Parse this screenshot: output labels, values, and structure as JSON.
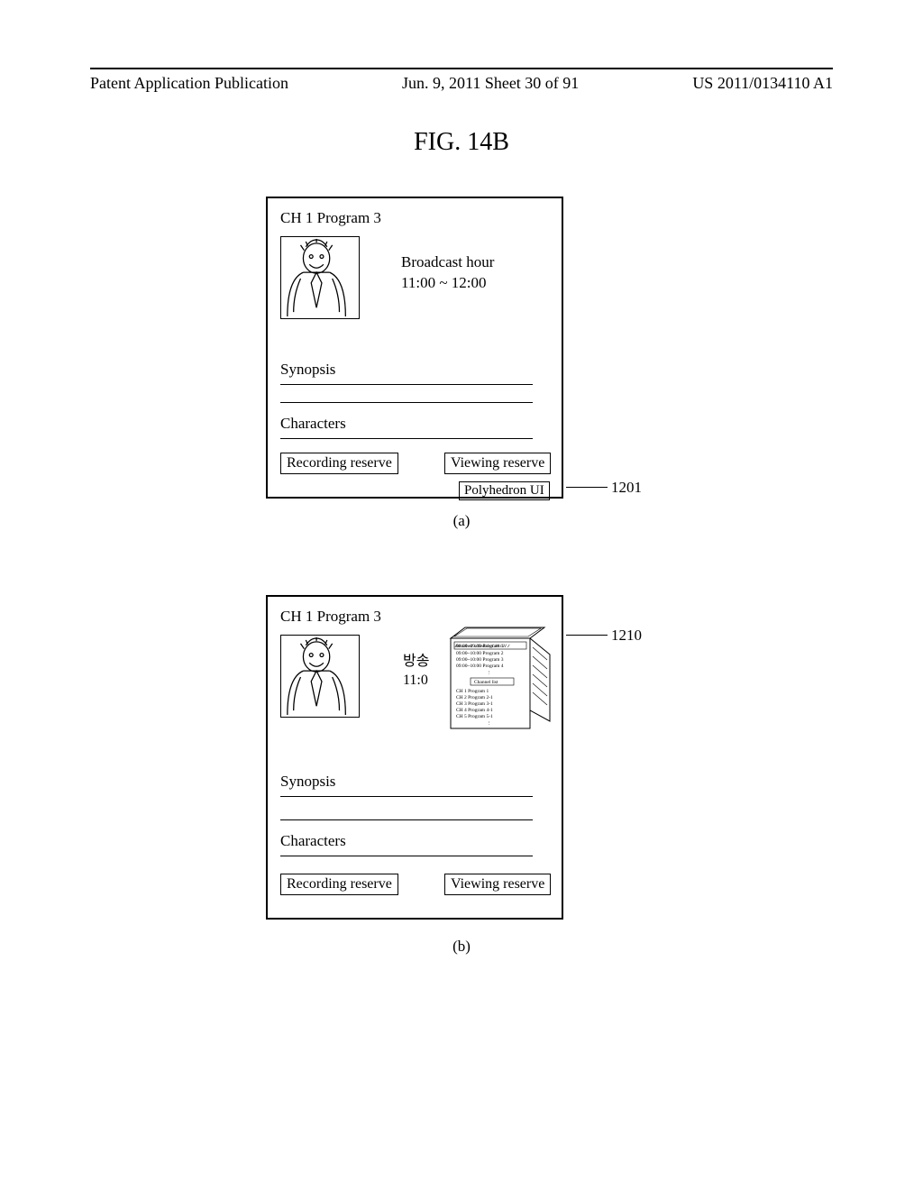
{
  "header": {
    "left": "Patent Application Publication",
    "mid": "Jun. 9, 2011  Sheet 30 of 91",
    "right": "US 2011/0134110 A1"
  },
  "figure_title": "FIG. 14B",
  "panel_a": {
    "title": "CH 1 Program 3",
    "broadcast_hour_label": "Broadcast hour",
    "broadcast_hour_value": "11:00 ~ 12:00",
    "synopsis_label": "Synopsis",
    "characters_label": "Characters",
    "recording_reserve": "Recording reserve",
    "viewing_reserve": "Viewing reserve",
    "polyhedron_ui": "Polyhedron UI",
    "sub_label": "(a)",
    "ref_1201": "1201"
  },
  "panel_b": {
    "title": "CH 1 Program 3",
    "bk_label_line1": "방송",
    "bk_label_line2": "11:0",
    "synopsis_label": "Synopsis",
    "characters_label": "Characters",
    "recording_reserve": "Recording reserve",
    "viewing_reserve": "Viewing reserve",
    "sub_label": "(b)",
    "ref_1210": "1210",
    "cube_top_header": "Broadcast schedule 6.30  CH 1",
    "cube_schedule": [
      "08:00~09:00    Program 1",
      "09:00~10:00    Program 2",
      "09:00~10:00    Program 3",
      "09:00~10:00    Program 4"
    ],
    "cube_channel_list_label": "Channel list",
    "cube_channel_list": [
      "CH 1   Program 1",
      "CH 2   Program 2-1",
      "CH 3   Program 3-1",
      "CH 4   Program 4-1",
      "CH 5   Program 5-1"
    ]
  }
}
